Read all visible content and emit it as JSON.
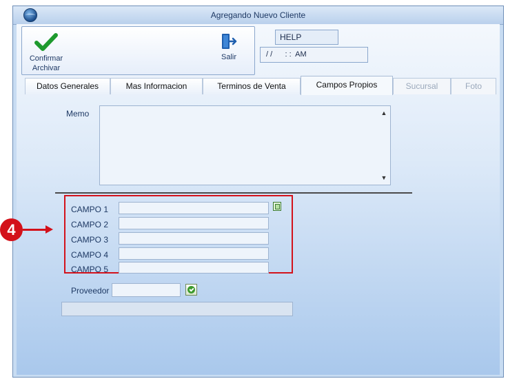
{
  "window": {
    "title": "Agregando Nuevo Cliente"
  },
  "toolbar": {
    "confirm_label_line1": "Confirmar",
    "confirm_label_line2": "Archivar",
    "exit_label": "Salir",
    "help_text": "HELP",
    "datetime_text": "/ /      : :  AM"
  },
  "tabs": [
    {
      "label": "Datos Generales",
      "state": "normal"
    },
    {
      "label": "Mas Informacion",
      "state": "normal"
    },
    {
      "label": "Terminos de Venta",
      "state": "normal"
    },
    {
      "label": "Campos Propios",
      "state": "active"
    },
    {
      "label": "Sucursal",
      "state": "disabled"
    },
    {
      "label": "Foto",
      "state": "disabled"
    }
  ],
  "panel": {
    "memo_label": "Memo",
    "memo_value": "",
    "campos": [
      {
        "label": "CAMPO 1",
        "value": ""
      },
      {
        "label": "CAMPO 2",
        "value": ""
      },
      {
        "label": "CAMPO 3",
        "value": ""
      },
      {
        "label": "CAMPO 4",
        "value": ""
      },
      {
        "label": "CAMPO 5",
        "value": ""
      }
    ],
    "proveedor_label": "Proveedor",
    "proveedor_value": "",
    "proveedor_desc": ""
  },
  "annotation": {
    "callout_number": "4",
    "color": "#d3111a"
  },
  "icons": {
    "confirm": "checkmark-icon",
    "exit": "exit-door-icon",
    "copy": "copy-icon",
    "ok": "ok-check-icon",
    "app": "globe-icon"
  }
}
